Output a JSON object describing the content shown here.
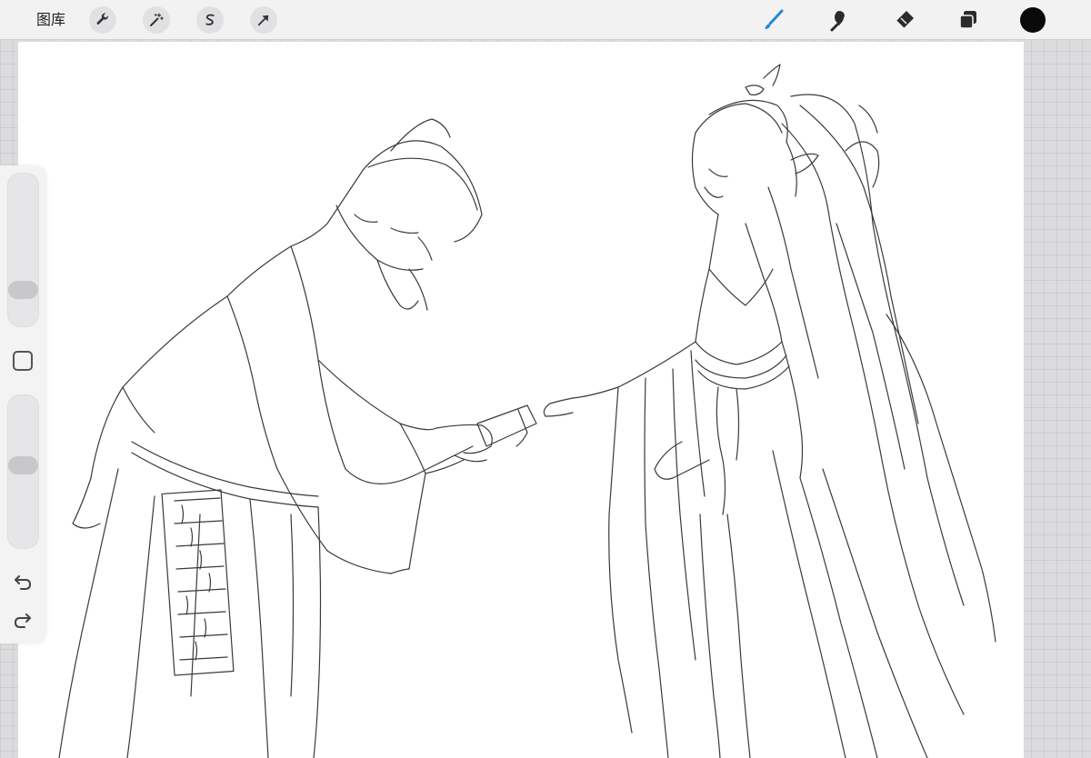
{
  "toolbar": {
    "gallery_label": "图库",
    "left_tools": [
      {
        "name": "actions",
        "icon": "wrench-icon"
      },
      {
        "name": "adjustments",
        "icon": "magic-wand-icon"
      },
      {
        "name": "selection",
        "icon": "selection-s-icon"
      },
      {
        "name": "transform",
        "icon": "arrow-cursor-icon"
      }
    ],
    "right_tools": [
      {
        "name": "brush",
        "icon": "brush-icon",
        "active": true
      },
      {
        "name": "smudge",
        "icon": "smudge-icon",
        "active": false
      },
      {
        "name": "eraser",
        "icon": "eraser-icon",
        "active": false
      },
      {
        "name": "layers",
        "icon": "layers-icon",
        "active": false
      }
    ],
    "current_color": "#0a0a0a",
    "active_color": "#1e8ad6"
  },
  "sidebar": {
    "brush_size_level": 0.2,
    "opacity_level": 0.55,
    "modify_icon": "square-icon",
    "undo_icon": "undo-icon",
    "redo_icon": "redo-icon"
  },
  "canvas": {
    "content": "pencil-sketch",
    "background": "#ffffff",
    "stroke_color": "#3a3a3a"
  }
}
